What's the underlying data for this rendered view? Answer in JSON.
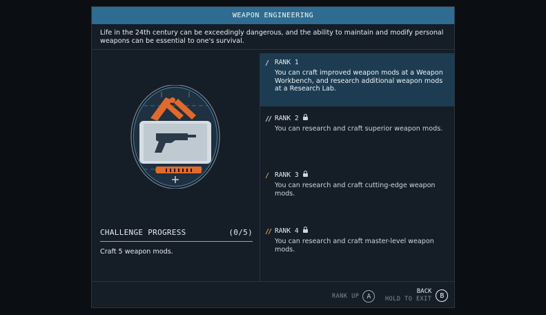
{
  "title": "WEAPON ENGINEERING",
  "description": "Life in the 24th century can be exceedingly dangerous, and the ability to maintain and modify personal weapons can be essential to one's survival.",
  "emblem": {
    "icon": "weapon-workbench-badge-icon"
  },
  "challenge": {
    "label": "CHALLENGE PROGRESS",
    "count": "(0/5)",
    "description": "Craft 5 weapon mods."
  },
  "ranks": [
    {
      "label": "RANK 1",
      "locked": false,
      "active": true,
      "bars_color": "#cfd6df",
      "text": "You can craft improved weapon mods at a Weapon Workbench, and research additional weapon mods at a Research Lab."
    },
    {
      "label": "RANK 2",
      "locked": true,
      "active": false,
      "bars_color": "#cfd6df",
      "text": "You can research and craft superior weapon mods."
    },
    {
      "label": "RANK 3",
      "locked": true,
      "active": false,
      "bars_color": "#e8a23a",
      "text": "You can research and craft cutting-edge weapon mods."
    },
    {
      "label": "RANK 4",
      "locked": true,
      "active": false,
      "bars_color": "#e8a23a",
      "text": "You can research and craft master-level weapon mods."
    }
  ],
  "footer": {
    "rank_up_label": "RANK UP",
    "rank_up_key": "A",
    "back_label": "BACK",
    "hold_label": "HOLD TO EXIT",
    "back_key": "B"
  },
  "colors": {
    "accent": "#2e6d91",
    "active_rank_bg": "#1d3c52",
    "orange": "#e06a2c"
  }
}
